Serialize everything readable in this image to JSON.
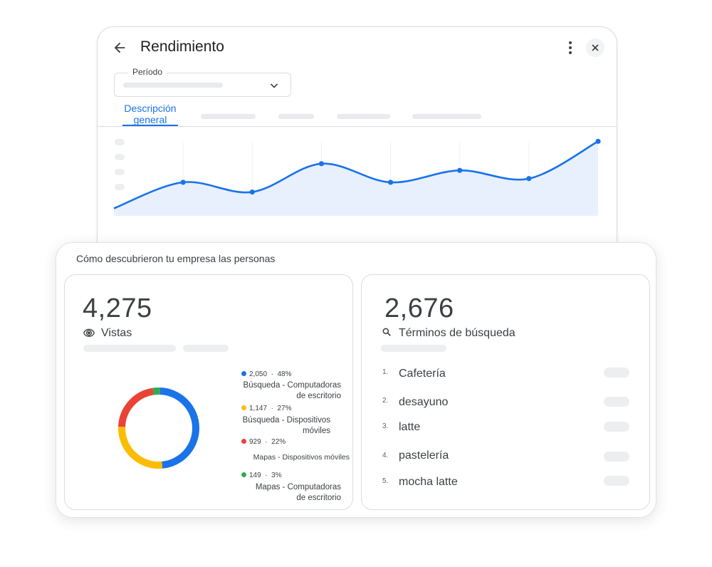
{
  "header": {
    "title": "Rendimiento",
    "back_icon": "arrow-back-icon",
    "more_icon": "more-vert-icon",
    "close_icon": "close-icon"
  },
  "period": {
    "label": "Período",
    "selected": ""
  },
  "tabs": [
    {
      "label": "Descripción general",
      "active": true
    },
    {
      "label": "",
      "active": false
    },
    {
      "label": "",
      "active": false
    },
    {
      "label": "",
      "active": false
    },
    {
      "label": "",
      "active": false
    }
  ],
  "chart_data": {
    "type": "area",
    "title": "",
    "xlabel": "",
    "ylabel": "",
    "x": [
      1,
      2,
      3,
      4,
      5,
      6,
      7,
      8
    ],
    "series": [
      {
        "values": [
          1.0,
          4.5,
          3.2,
          7.0,
          4.5,
          6.1,
          5.0,
          10.0
        ]
      }
    ],
    "ylim": [
      0,
      11
    ],
    "grid": "vertical",
    "line_color": "#1a73e8",
    "fill_color": "#e8f0fe"
  },
  "discovery": {
    "heading": "Cómo descubrieron tu empresa las personas",
    "views": {
      "total": "4,275",
      "label": "Vistas",
      "icon": "eye-icon",
      "breakdown": [
        {
          "value": "2,050",
          "percent": "48%",
          "name_line1": "Búsqueda - Computadoras",
          "name_line2": "de escritorio",
          "color": "#1a73e8",
          "share": 48
        },
        {
          "value": "1,147",
          "percent": "27%",
          "name_line1": "Búsqueda - Dispositivos",
          "name_line2": "móviles",
          "color": "#fbbc04",
          "share": 27
        },
        {
          "value": "929",
          "percent": "22%",
          "name_line1": "Mapas - Dispositivos móviles",
          "name_line2": "",
          "color": "#ea4335",
          "share": 22
        },
        {
          "value": "149",
          "percent": "3%",
          "name_line1": "Mapas - Computadoras",
          "name_line2": "de escritorio",
          "color": "#34a853",
          "share": 3
        }
      ]
    },
    "searches": {
      "total": "2,676",
      "label": "Términos de búsqueda",
      "icon": "search-icon",
      "terms": [
        {
          "rank": "1.",
          "term": "Cafetería"
        },
        {
          "rank": "2.",
          "term": "desayuno"
        },
        {
          "rank": "3.",
          "term": "latte"
        },
        {
          "rank": "4.",
          "term": "pastelería"
        },
        {
          "rank": "5.",
          "term": "mocha latte"
        }
      ]
    }
  }
}
